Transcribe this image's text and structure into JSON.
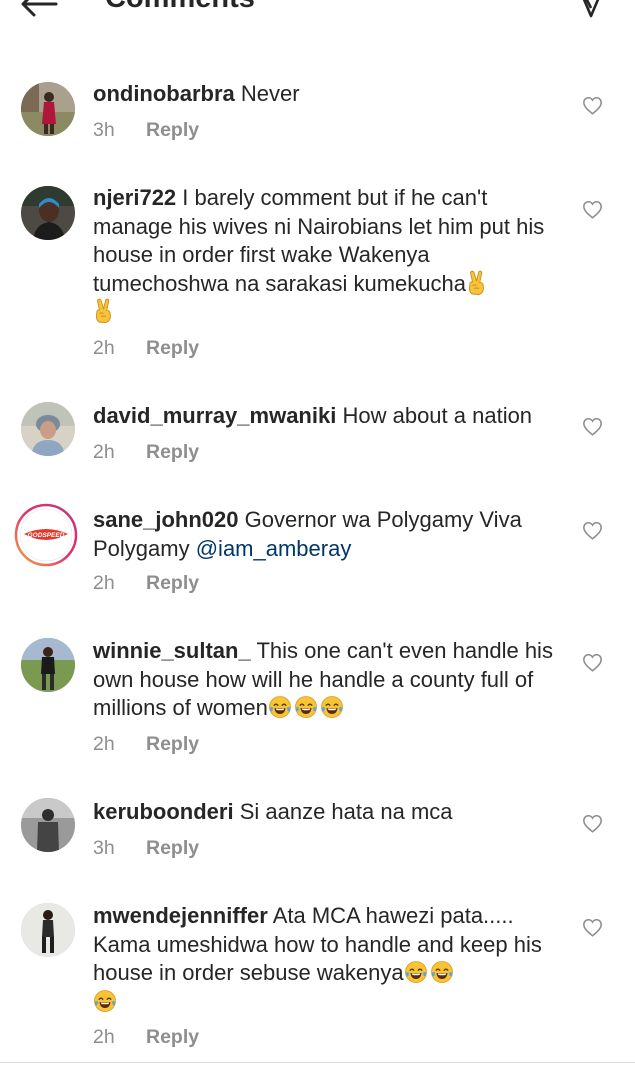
{
  "header": {
    "title": "Comments",
    "back_icon": "arrow-left-icon",
    "share_icon": "send-icon"
  },
  "comments": [
    {
      "username": "ondinobarbra",
      "text": "Never",
      "time": "3h",
      "reply": "Reply"
    },
    {
      "username": "njeri722",
      "text": "I barely comment but if he can't manage his wives ni Nairobians let him put his house in order first wake Wakenya tumechoshwa na sarakasi kumekucha",
      "time": "2h",
      "reply": "Reply"
    },
    {
      "username": "david_murray_mwaniki",
      "text": "How about a nation",
      "time": "2h",
      "reply": "Reply"
    },
    {
      "username": "sane_john020",
      "text": "Governor wa Polygamy Viva Polygamy",
      "mention": "@iam_amberay",
      "time": "2h",
      "reply": "Reply",
      "avatar_text": "GODSPEED"
    },
    {
      "username": "winnie_sultan_",
      "text": "This one can't even handle his own house how will he handle a county full of millions of women",
      "time": "2h",
      "reply": "Reply"
    },
    {
      "username": "keruboonderi",
      "text": "Si aanze hata na mca",
      "time": "3h",
      "reply": "Reply"
    },
    {
      "username": "mwendejenniffer",
      "text": "Ata MCA hawezi pata..... Kama umeshidwa how to handle and keep his house in order sebuse wakenya",
      "time": "2h",
      "reply": "Reply"
    }
  ],
  "colors": {
    "text": "#262626",
    "meta": "#8e8e8e",
    "mention": "#00376b",
    "divider": "#dbdbdb"
  },
  "icons": {
    "like": "heart-outline-icon",
    "laugh": "face-with-tears-of-joy-emoji",
    "peace": "victory-hand-emoji"
  }
}
